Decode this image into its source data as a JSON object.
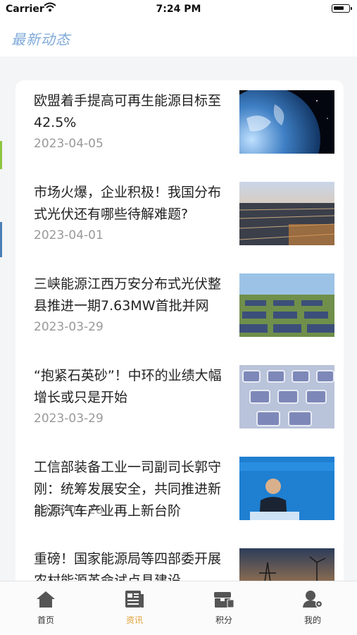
{
  "status_bar": {
    "carrier": "Carrier",
    "time": "7:24 PM"
  },
  "nav": {
    "title": "最新动态"
  },
  "news": [
    {
      "title": "欧盟着手提高可再生能源目标至42.5%",
      "date": "2023-04-05",
      "image": "earth-from-space"
    },
    {
      "title": "市场火爆，企业积极！我国分布式光伏还有哪些待解难题?",
      "date": "2023-04-01",
      "image": "solar-panels-sunset"
    },
    {
      "title": "三峡能源江西万安分布式光伏整县推进一期7.63MW首批并网",
      "date": "2023-03-29",
      "image": "solar-farm-field"
    },
    {
      "title": "“抱紧石英砂”！中环的业绩大幅增长或只是开始",
      "date": "2023-03-29",
      "image": "silicon-wafers"
    },
    {
      "title": "工信部装备工业一司副司长郭守刚：统筹发展安全，共同推进新能源汽车产业再上新台阶",
      "date": "2023-03-28",
      "image": "speaker-at-podium"
    },
    {
      "title": "重磅！国家能源局等四部委开展农村能源革命试点县建设",
      "date": "",
      "image": "power-towers-wind-turbines"
    }
  ],
  "tabs": [
    {
      "label": "首页",
      "icon": "home-icon",
      "active": false
    },
    {
      "label": "资讯",
      "icon": "news-icon",
      "active": true
    },
    {
      "label": "积分",
      "icon": "points-icon",
      "active": false
    },
    {
      "label": "我的",
      "icon": "profile-icon",
      "active": false
    }
  ],
  "colors": {
    "accent": "#e0a33a",
    "title": "#7ea9d9",
    "icon": "#555555"
  }
}
